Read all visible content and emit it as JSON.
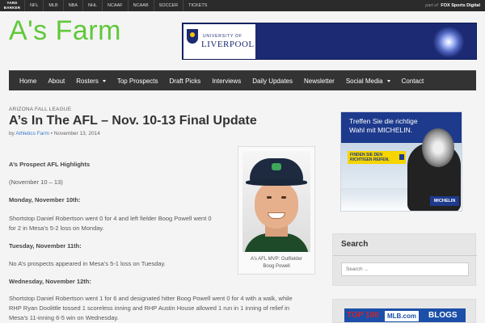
{
  "network_bar": {
    "logo": "YARD BARKER",
    "links": [
      "NFL",
      "MLB",
      "NBA",
      "NHL",
      "NCAAF",
      "NCAAB",
      "SOCCER",
      "TICKETS"
    ],
    "part_of_prefix": "part of",
    "part_of_brand": "FOX Sports Digital"
  },
  "header": {
    "site_title": "A's Farm",
    "banner_ad": {
      "line1": "UNIVERSITY OF",
      "line2": "LIVERPOOL"
    }
  },
  "nav": {
    "items": [
      {
        "label": "Home",
        "dropdown": false
      },
      {
        "label": "About",
        "dropdown": false
      },
      {
        "label": "Rosters",
        "dropdown": true
      },
      {
        "label": "Top Prospects",
        "dropdown": false
      },
      {
        "label": "Draft Picks",
        "dropdown": false
      },
      {
        "label": "Interviews",
        "dropdown": false
      },
      {
        "label": "Daily Updates",
        "dropdown": false
      },
      {
        "label": "Newsletter",
        "dropdown": false
      },
      {
        "label": "Social Media",
        "dropdown": true
      },
      {
        "label": "Contact",
        "dropdown": false
      }
    ]
  },
  "post": {
    "category": "ARIZONA FALL LEAGUE",
    "title": "A’s In The AFL – Nov. 10-13 Final Update",
    "byline_prefix": "by",
    "author": "Athletics Farm",
    "separator": "•",
    "date": "November 13, 2014",
    "figure_caption_line1": "A’s AFL MVP: Outfielder",
    "figure_caption_line2": "Boog Powell",
    "body": {
      "heading": "A’s Prospect AFL Highlights",
      "range": "(November 10 – 13)",
      "day1_heading": "Monday, November 10th:",
      "day1_line1": "Shortstop Daniel Robertson went 0 for 4 and left fielder Boog Powell went 0",
      "day1_line2": "for 2 in Mesa’s 5-2 loss on Monday.",
      "day2_heading": "Tuesday, November 11th:",
      "day2_text": "No A’s prospects appeared in Mesa’s 5-1 loss on Tuesday.",
      "day3_heading": "Wednesday, November 12th:",
      "day3_line1": "Shortstop Daniel Robertson went 1 for 6 and designated hitter Boog Powell went 0 for 4 with a walk, while",
      "day3_line2": "RHP Ryan Doolittle tossed 1 scoreless inning and RHP Austin House allowed 1 run in 1 inning of relief in",
      "day3_line3": "Mesa’s 11-inning 6-5 win on Wednesday."
    }
  },
  "sidebar": {
    "ad": {
      "line1": "Treffen Sie die richtige",
      "line2": "Wahl mit MICHELIN.",
      "tag_line1": "FINDEN SIE DEN",
      "tag_line2": "RICHTIGEN REIFEN.",
      "brand": "MICHELIN"
    },
    "search": {
      "title": "Search",
      "placeholder": "Search ..."
    },
    "blogs_banner": {
      "top100": "TOP 100",
      "mlb": "MLB.com",
      "blogs": "BLOGS"
    }
  },
  "colors": {
    "site_title": "#60c83a",
    "nav_bg": "#333333",
    "link": "#3a7ac8",
    "banner_bg": "#1c2a73"
  }
}
